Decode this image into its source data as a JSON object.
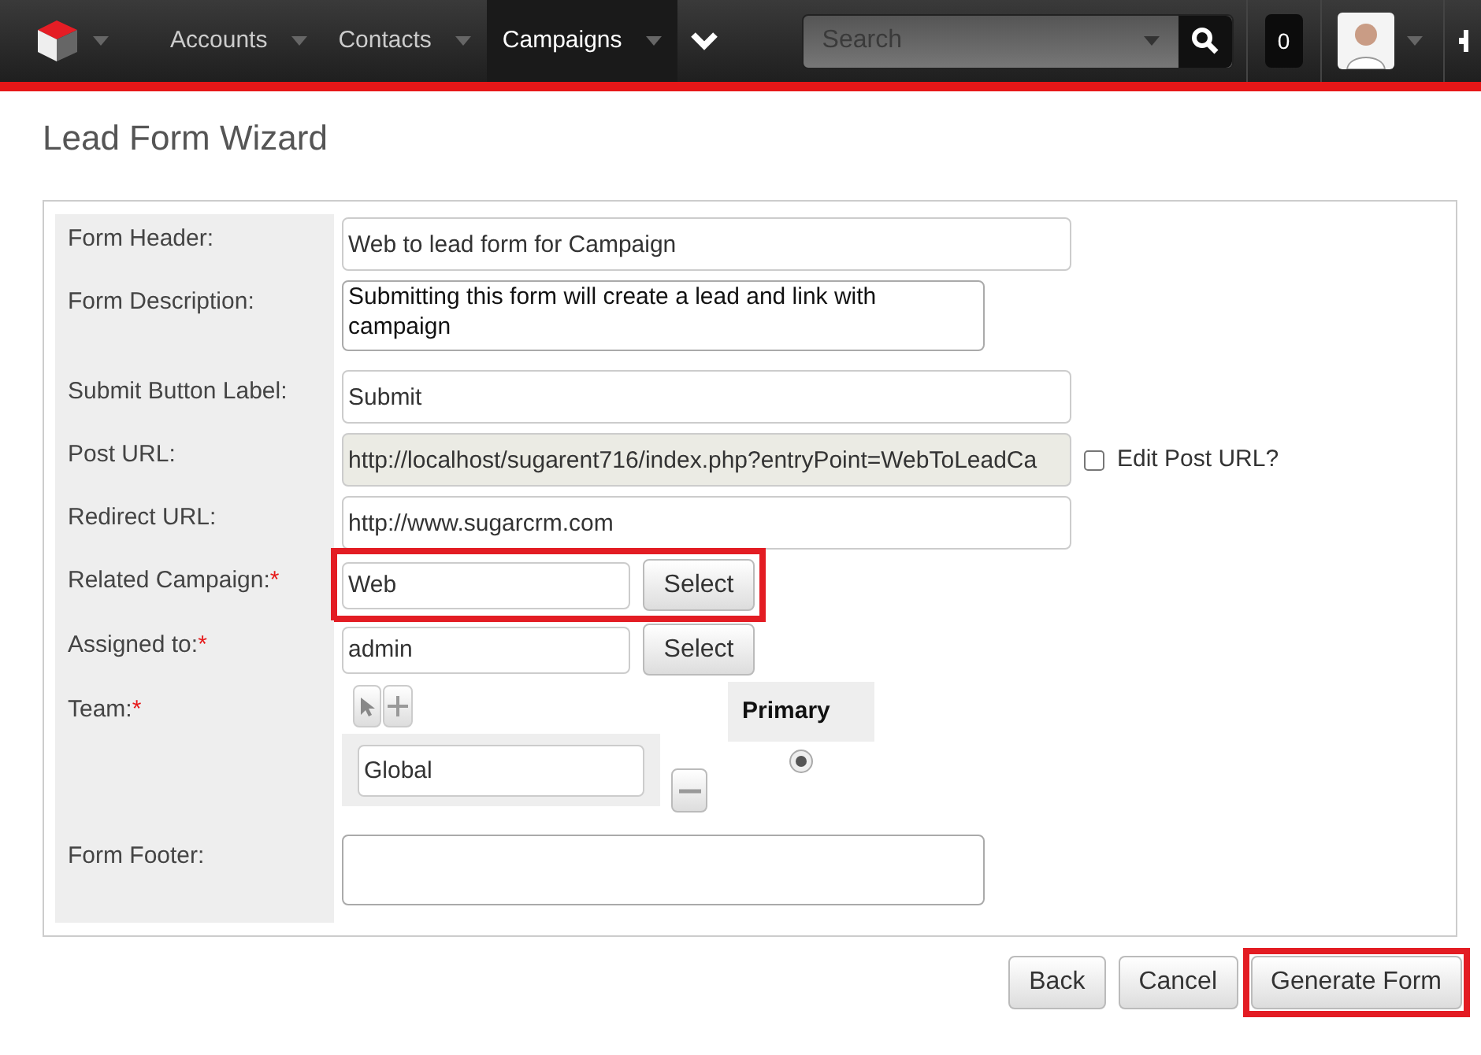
{
  "nav": {
    "tabs": [
      {
        "label": "Accounts",
        "selected": false
      },
      {
        "label": "Contacts",
        "selected": false
      },
      {
        "label": "Campaigns",
        "selected": true
      }
    ],
    "search": {
      "placeholder": "Search"
    },
    "notifications": "0"
  },
  "title": "Lead Form Wizard",
  "fields": [
    {
      "kind": "text",
      "label": "Form Header:",
      "value": "Web to lead form for Campaign"
    },
    {
      "kind": "textarea",
      "label": "Form Description:",
      "value": "Submitting this form will create a lead and link with campaign"
    },
    {
      "kind": "text",
      "label": "Submit Button Label:",
      "value": "Submit"
    },
    {
      "kind": "url",
      "label": "Post URL:",
      "value": "http://localhost/sugarent716/index.php?entryPoint=WebToLeadCa",
      "disabled": true,
      "checkbox": {
        "label": "Edit Post URL?",
        "checked": false
      }
    },
    {
      "kind": "text",
      "label": "Redirect URL:",
      "value": "http://www.sugarcrm.com"
    },
    {
      "kind": "select",
      "label": "Related Campaign:",
      "required_mark": "*",
      "value": "Web",
      "button": "Select",
      "highlighted": true
    },
    {
      "kind": "select",
      "label": "Assigned to:",
      "required_mark": "*",
      "value": "admin",
      "button": "Select",
      "highlighted": false
    },
    {
      "kind": "team",
      "label": "Team:",
      "required_mark": "*",
      "value": "Global",
      "primary_header": "Primary",
      "primary": true
    },
    {
      "kind": "footer",
      "label": "Form Footer:"
    }
  ],
  "buttons": [
    {
      "label": "Back",
      "highlighted": false
    },
    {
      "label": "Cancel",
      "highlighted": false
    },
    {
      "label": "Generate Form",
      "highlighted": true
    }
  ]
}
